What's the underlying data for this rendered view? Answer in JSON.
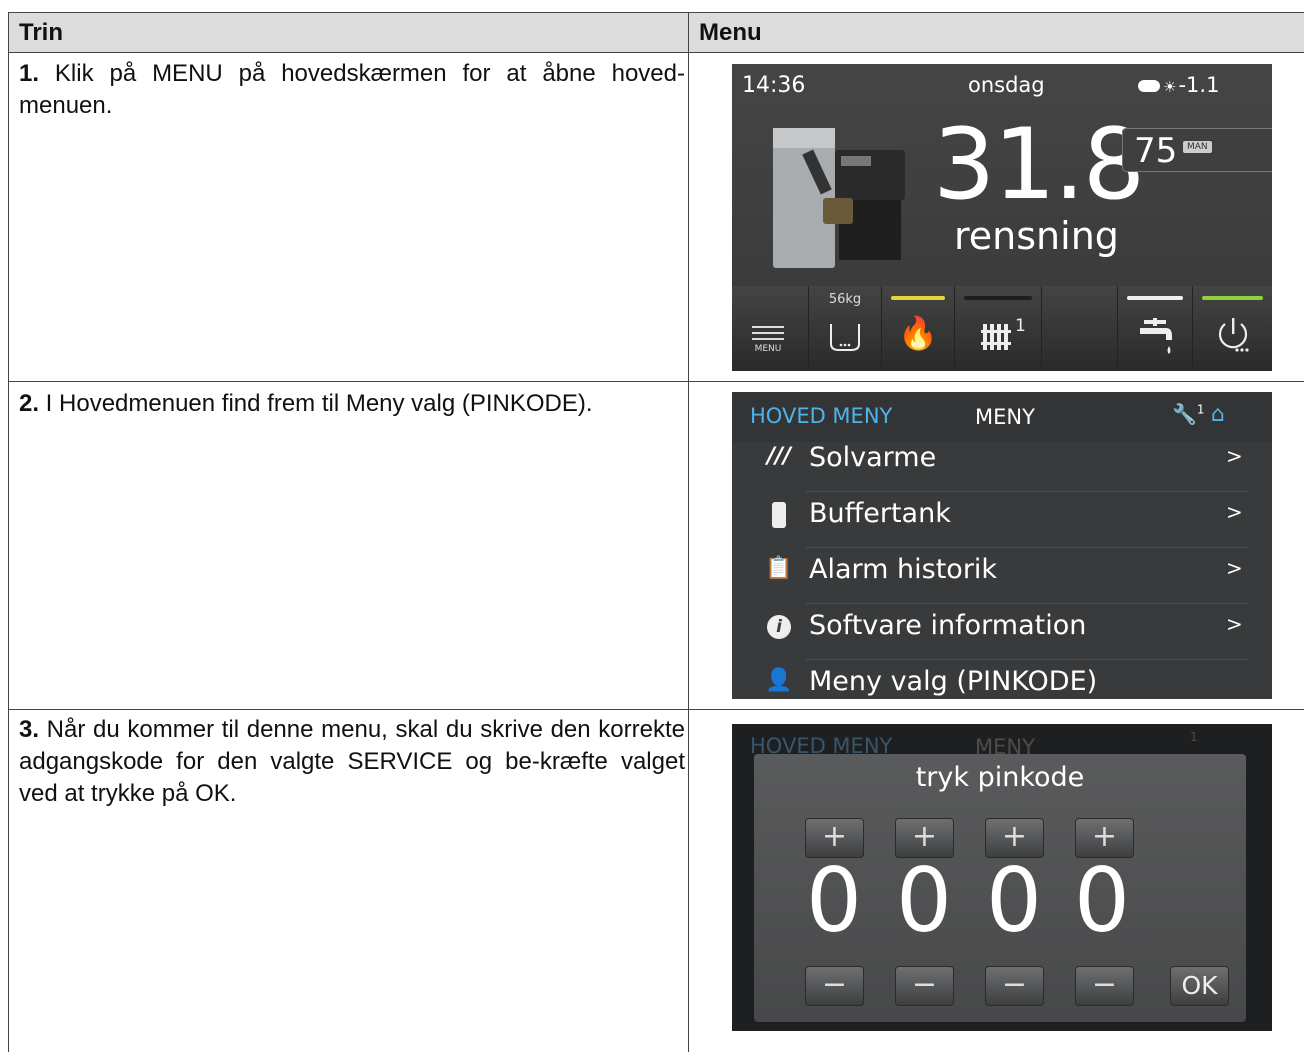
{
  "table": {
    "header_step": "Trin",
    "header_menu": "Menu",
    "rows": [
      {
        "num": "1.",
        "text": " Klik på MENU på hovedskærmen for at åbne hoved-menuen."
      },
      {
        "num": "2.",
        "text": " I Hovedmenuen find frem til Meny valg (PINKODE)."
      },
      {
        "num": "3.",
        "text": " Når du kommer til denne menu, skal du skrive den korrekte adgangskode for den valgte SERVICE og be-kræfte valget ved at trykke på OK."
      }
    ]
  },
  "screen1": {
    "time": "14:36",
    "day": "onsdag",
    "outdoor_temp": "-1.1",
    "boiler_temp": "31.8",
    "status": "rensning",
    "setpoint": "75",
    "mode_badge": "MAN",
    "toolbar": {
      "menu_label": "MENU",
      "hopper_weight": "56kg",
      "heating_circuit_number": "1"
    },
    "indicator_colors": {
      "burner": "#e6d53a",
      "circuit": "#222222",
      "water": "#f0f0f0",
      "power": "#8fd13a"
    }
  },
  "screen2": {
    "title": "HOVED MENY",
    "subtitle": "MENY",
    "user_level": "1",
    "items": [
      {
        "label": "Solvarme",
        "arrow": ">",
        "icon": "solar-collector-icon"
      },
      {
        "label": "Buffertank",
        "arrow": ">",
        "icon": "buffer-tank-icon"
      },
      {
        "label": "Alarm historik",
        "arrow": ">",
        "icon": "alarm-history-icon"
      },
      {
        "label": "Softvare information",
        "arrow": ">",
        "icon": "info-icon"
      },
      {
        "label": "Meny valg (PINKODE)",
        "arrow": "",
        "icon": "user-lock-icon"
      }
    ]
  },
  "screen3": {
    "bg_title": "HOVED MENY",
    "bg_subtitle": "MENY",
    "bg_user_level": "1",
    "prompt": "tryk pinkode",
    "digits": [
      "0",
      "0",
      "0",
      "0"
    ],
    "plus": "+",
    "minus": "−",
    "ok_label": "OK"
  }
}
